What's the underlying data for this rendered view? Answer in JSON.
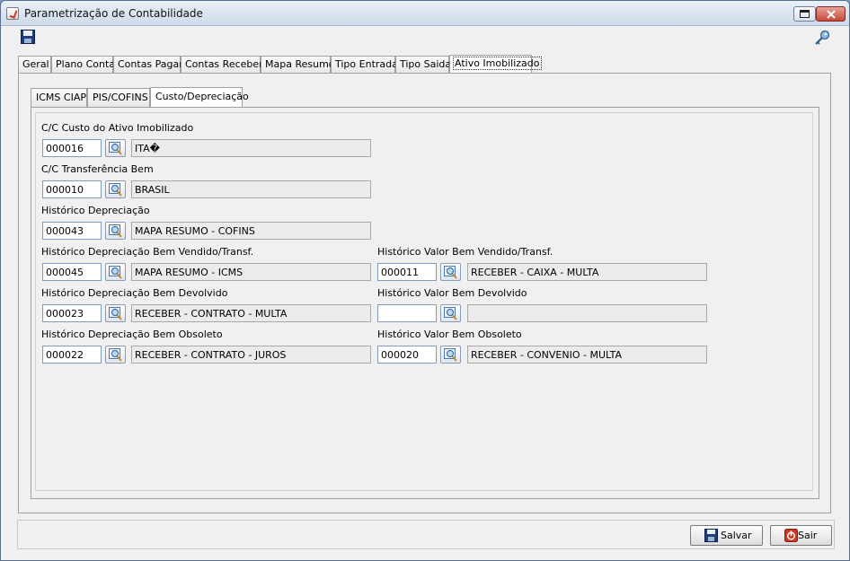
{
  "window": {
    "title": "Parametrização de Contabilidade"
  },
  "main_tabs": [
    "Geral",
    "Plano Conta",
    "Contas Pagar",
    "Contas Receber",
    "Mapa Resumo",
    "Tipo Entrada",
    "Tipo Saida",
    "Ativo Imobilizado"
  ],
  "main_tab_active": "Ativo Imobilizado",
  "sub_tabs": [
    "ICMS CIAP",
    "PIS/COFINS",
    "Custo/Depreciação"
  ],
  "sub_tab_active": "Custo/Depreciação",
  "fields": {
    "cc_custo": {
      "label": "C/C Custo do Ativo Imobilizado",
      "code": "000016",
      "desc": "ITA�"
    },
    "cc_transf": {
      "label": "C/C Transferência Bem",
      "code": "000010",
      "desc": "BRASIL"
    },
    "hist_depr": {
      "label": "Histórico Depreciação",
      "code": "000043",
      "desc": "MAPA RESUMO - COFINS"
    },
    "hist_depr_vend": {
      "label": "Histórico Depreciação Bem Vendido/Transf.",
      "code": "000045",
      "desc": "MAPA RESUMO - ICMS"
    },
    "hist_valor_vend": {
      "label": "Histórico Valor Bem Vendido/Transf.",
      "code": "000011",
      "desc": "RECEBER - CAIXA - MULTA"
    },
    "hist_depr_dev": {
      "label": "Histórico Depreciação Bem Devolvido",
      "code": "000023",
      "desc": "RECEBER - CONTRATO - MULTA"
    },
    "hist_valor_dev": {
      "label": "Histórico Valor Bem Devolvido",
      "code": "",
      "desc": ""
    },
    "hist_depr_obs": {
      "label": "Histórico Depreciação Bem Obsoleto",
      "code": "000022",
      "desc": "RECEBER - CONTRATO - JUROS"
    },
    "hist_valor_obs": {
      "label": "Histórico Valor Bem Obsoleto",
      "code": "000020",
      "desc": "RECEBER - CONVENIO - MULTA"
    }
  },
  "buttons": {
    "save_label": "Salvar",
    "exit_label": "Sair"
  },
  "icons": {
    "window": "java-icon",
    "toolbar_save": "floppy-disk-icon",
    "toolbar_key": "key-icon",
    "search": "magnifier-icon",
    "exit": "power-icon"
  },
  "colors": {
    "exit_icon": "#d0341e",
    "save_icon": "#1f3d7a"
  }
}
